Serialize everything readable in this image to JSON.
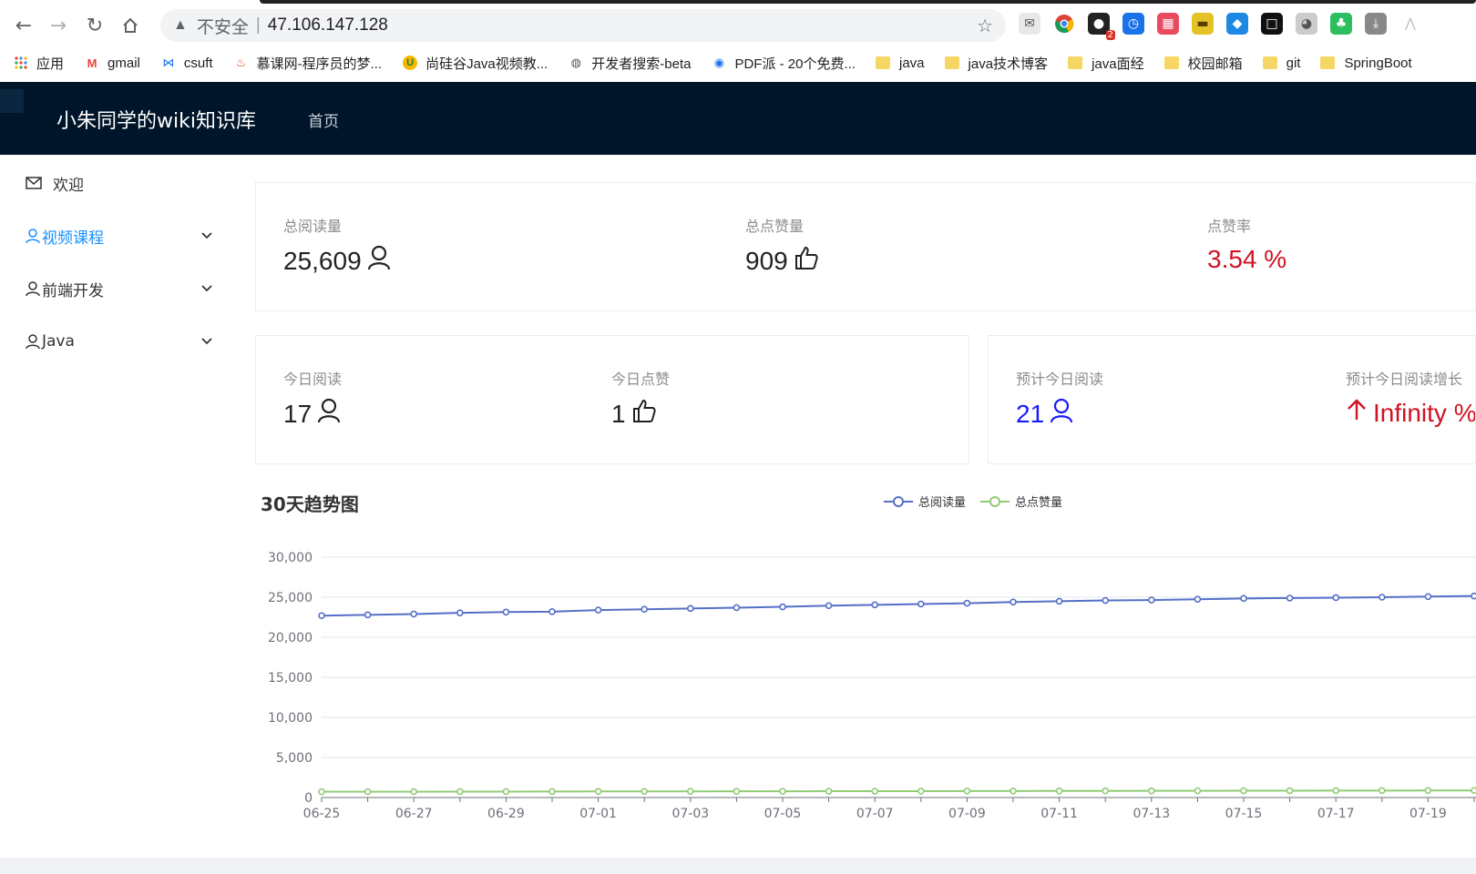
{
  "browser": {
    "insecure_label": "不安全",
    "separator": "|",
    "url": "47.106.147.128",
    "bookmarks": [
      {
        "label": "应用",
        "icon": "apps-grid-icon"
      },
      {
        "label": "gmail",
        "icon": "gmail-icon"
      },
      {
        "label": "csuft",
        "icon": "csuft-icon"
      },
      {
        "label": "慕课网-程序员的梦...",
        "icon": "flame-icon"
      },
      {
        "label": "尚硅谷Java视频教...",
        "icon": "u-icon"
      },
      {
        "label": "开发者搜索-beta",
        "icon": "globe-icon"
      },
      {
        "label": "PDF派 - 20个免费...",
        "icon": "pdf-icon"
      },
      {
        "label": "java",
        "icon": "folder-icon"
      },
      {
        "label": "java技术博客",
        "icon": "folder-icon"
      },
      {
        "label": "java面经",
        "icon": "folder-icon"
      },
      {
        "label": "校园邮箱",
        "icon": "folder-icon"
      },
      {
        "label": "git",
        "icon": "folder-icon"
      },
      {
        "label": "SpringBoot",
        "icon": "folder-icon"
      }
    ],
    "extension_badge": "2"
  },
  "header": {
    "title": "小朱同学的wiki知识库",
    "nav_home": "首页"
  },
  "sidebar": {
    "items": [
      {
        "label": "欢迎"
      },
      {
        "label": "视频课程"
      },
      {
        "label": "前端开发"
      },
      {
        "label": "Java"
      }
    ]
  },
  "stats_top": {
    "total_views_label": "总阅读量",
    "total_views": "25,609",
    "total_likes_label": "总点赞量",
    "total_likes": "909",
    "like_rate_label": "点赞率",
    "like_rate": "3.54 %"
  },
  "stats_today": {
    "views_label": "今日阅读",
    "views": "17",
    "likes_label": "今日点赞",
    "likes": "1"
  },
  "stats_forecast": {
    "views_label": "预计今日阅读",
    "views": "21",
    "growth_label": "预计今日阅读增长",
    "growth": "Infinity %"
  },
  "chart_data": {
    "type": "line",
    "title": "30天趋势图",
    "x": [
      "06-25",
      "06-26",
      "06-27",
      "06-28",
      "06-29",
      "06-30",
      "07-01",
      "07-02",
      "07-03",
      "07-04",
      "07-05",
      "07-06",
      "07-07",
      "07-08",
      "07-09",
      "07-10",
      "07-11",
      "07-12",
      "07-13",
      "07-14",
      "07-15",
      "07-16",
      "07-17",
      "07-18",
      "07-19",
      "07-20"
    ],
    "x_tick_labels": [
      "06-25",
      "06-27",
      "06-29",
      "07-01",
      "07-03",
      "07-05",
      "07-07",
      "07-09",
      "07-11",
      "07-13",
      "07-15",
      "07-17",
      "07-19"
    ],
    "series": [
      {
        "name": "总阅读量",
        "color": "#5470c6",
        "values": [
          22700,
          22800,
          22900,
          23050,
          23150,
          23200,
          23400,
          23500,
          23600,
          23700,
          23800,
          23950,
          24050,
          24150,
          24250,
          24400,
          24500,
          24600,
          24650,
          24750,
          24850,
          24900,
          24950,
          25000,
          25080,
          25150
        ]
      },
      {
        "name": "总点赞量",
        "color": "#91cc75",
        "values": [
          720,
          725,
          730,
          740,
          745,
          750,
          760,
          765,
          770,
          775,
          780,
          790,
          795,
          800,
          810,
          815,
          820,
          830,
          835,
          840,
          850,
          855,
          860,
          870,
          875,
          880
        ]
      }
    ],
    "yticks": [
      "0",
      "5,000",
      "10,000",
      "15,000",
      "20,000",
      "25,000",
      "30,000"
    ],
    "ylim": [
      0,
      30000
    ],
    "grid": true,
    "legend": "top-center"
  }
}
